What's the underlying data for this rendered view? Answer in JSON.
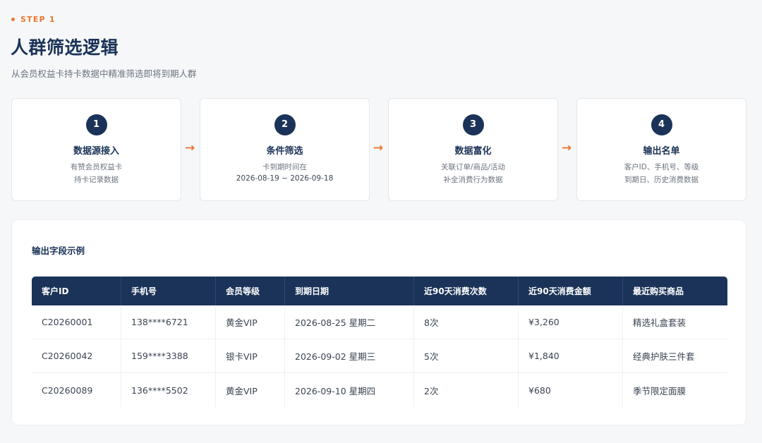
{
  "header": {
    "step_label": "STEP 1",
    "title": "人群筛选逻辑",
    "subtitle": "从会员权益卡持卡数据中精准筛选即将到期人群"
  },
  "steps": [
    {
      "number": "1",
      "title": "数据源接入",
      "desc_line1": "有赞会员权益卡",
      "desc_line2": "持卡记录数据"
    },
    {
      "number": "2",
      "title": "条件筛选",
      "desc_line1": "卡到期时间在",
      "desc_line2": "2026-08-19 ~ 2026-09-18"
    },
    {
      "number": "3",
      "title": "数据富化",
      "desc_line1": "关联订单/商品/活动",
      "desc_line2": "补全消费行为数据"
    },
    {
      "number": "4",
      "title": "输出名单",
      "desc_line1": "客户ID、手机号、等级",
      "desc_line2": "到期日、历史消费数据"
    }
  ],
  "arrow_glyph": "→",
  "output": {
    "title": "输出字段示例",
    "columns": [
      "客户ID",
      "手机号",
      "会员等级",
      "到期日期",
      "近90天消费次数",
      "近90天消费金额",
      "最近购买商品"
    ],
    "rows": [
      [
        "C20260001",
        "138****6721",
        "黄金VIP",
        "2026-08-25 星期二",
        "8次",
        "¥3,260",
        "精选礼盒套装"
      ],
      [
        "C20260042",
        "159****3388",
        "银卡VIP",
        "2026-09-02 星期三",
        "5次",
        "¥1,840",
        "经典护肤三件套"
      ],
      [
        "C20260089",
        "136****5502",
        "黄金VIP",
        "2026-09-10 星期四",
        "2次",
        "¥680",
        "季节限定面膜"
      ]
    ]
  },
  "colors": {
    "accent": "#e8772e",
    "navy": "#1b3358",
    "background": "#f6f7f9"
  },
  "icons": {
    "arrow": "arrow-right-icon"
  }
}
